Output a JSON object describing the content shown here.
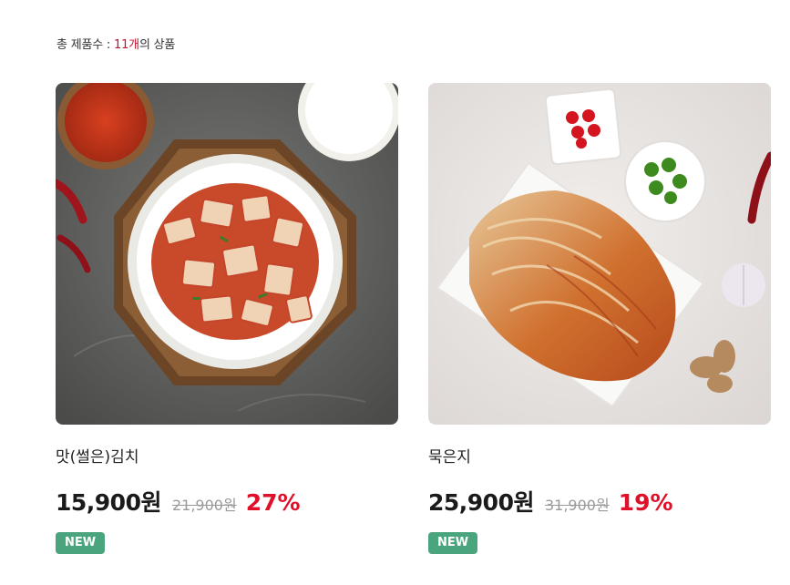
{
  "summary": {
    "prefix": "총 제품수 : ",
    "count": "11개",
    "suffix": "의 상품"
  },
  "products": [
    {
      "name": "맛(썰은)김치",
      "price": "15,900원",
      "original_price": "21,900원",
      "discount": "27%",
      "badge": "NEW"
    },
    {
      "name": "묵은지",
      "price": "25,900원",
      "original_price": "31,900원",
      "discount": "19%",
      "badge": "NEW"
    }
  ],
  "colors": {
    "discount": "#e0102a",
    "badge": "#4aa57e",
    "count_highlight": "#c8102e"
  }
}
